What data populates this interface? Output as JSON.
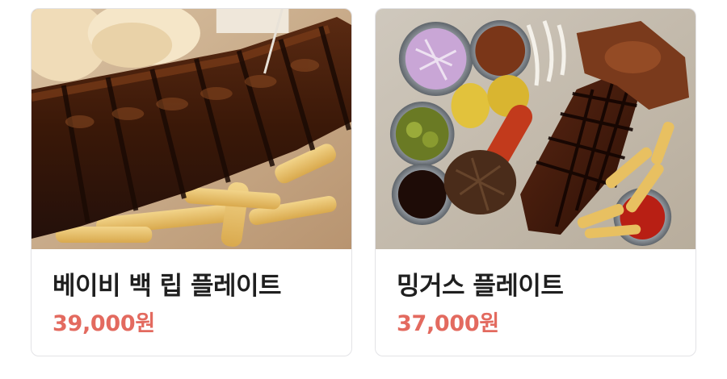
{
  "menu": {
    "items": [
      {
        "name": "베이비 백 립 플레이트",
        "price": "39,000원"
      },
      {
        "name": "밍거스 플레이트",
        "price": "37,000원"
      }
    ]
  },
  "colors": {
    "price": "#e36a5f",
    "name": "#1f1f1f",
    "card_border": "#e3e3e6"
  }
}
